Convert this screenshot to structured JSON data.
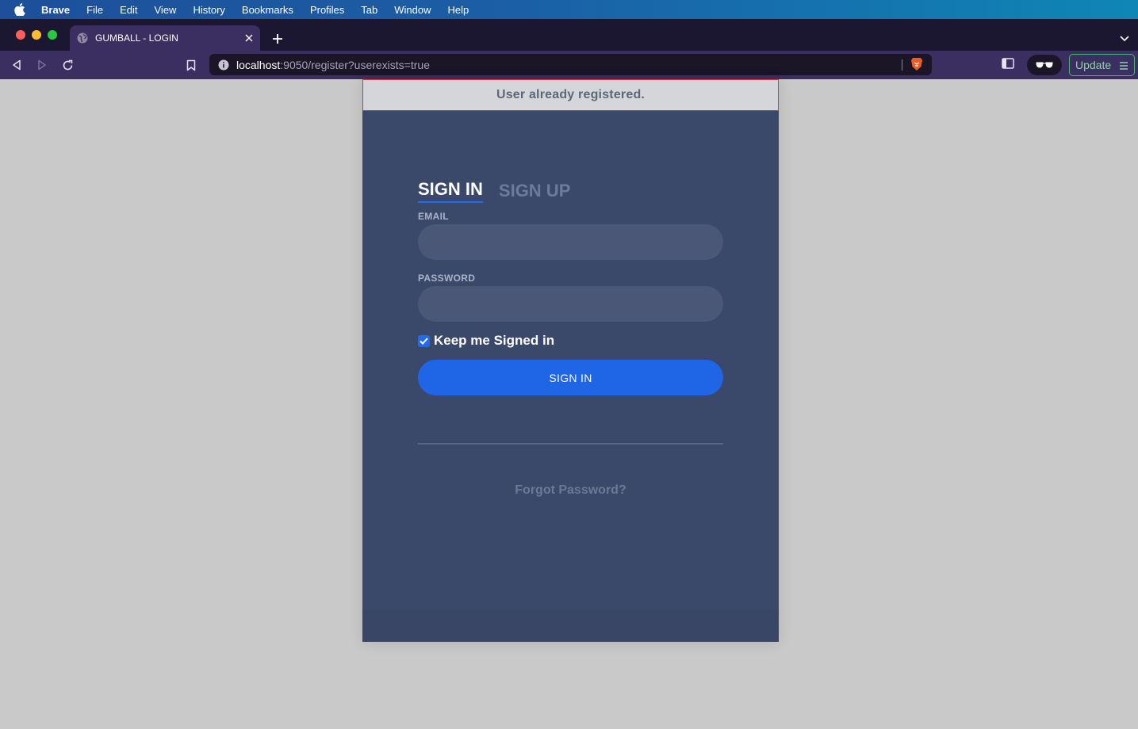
{
  "menubar": {
    "items": [
      "Brave",
      "File",
      "Edit",
      "View",
      "History",
      "Bookmarks",
      "Profiles",
      "Tab",
      "Window",
      "Help"
    ]
  },
  "browser": {
    "tab_title": "GUMBALL - LOGIN",
    "url_host": "localhost",
    "url_path": ":9050/register?userexists=true",
    "update_label": "Update"
  },
  "page": {
    "alert": "User already registered.",
    "tab_signin": "SIGN IN",
    "tab_signup": "SIGN UP",
    "email_label": "EMAIL",
    "password_label": "PASSWORD",
    "email_value": "",
    "password_value": "",
    "keep_signed_in": "Keep me Signed in",
    "signin_button": "SIGN IN",
    "forgot_password": "Forgot Password?"
  },
  "colors": {
    "page_bg": "#c9c9c9",
    "panel_bg": "#3a4869",
    "accent": "#1f66e6",
    "alert_border": "#e0353a"
  }
}
